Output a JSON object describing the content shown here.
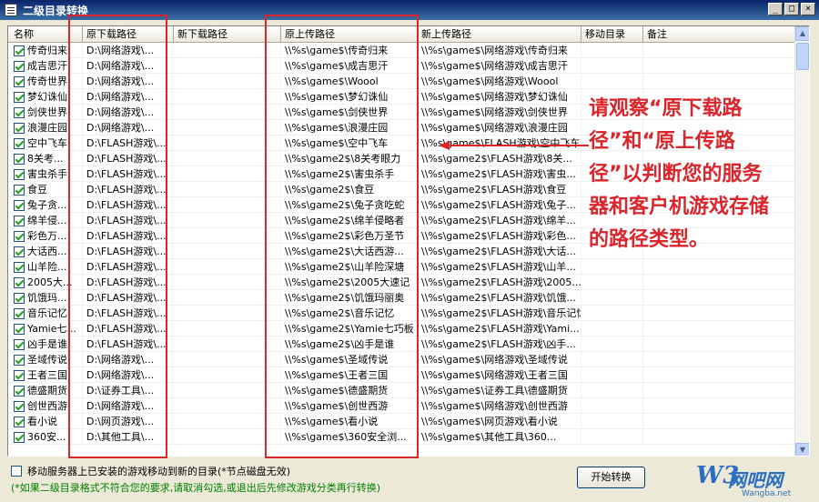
{
  "window": {
    "title": "二级目录转换",
    "controls": [
      "_",
      "□",
      "×"
    ]
  },
  "columns": [
    "名称",
    "原下载路径",
    "新下载路径",
    "原上传路径",
    "新上传路径",
    "移动目录",
    "备注"
  ],
  "rows": [
    {
      "checked": true,
      "name": "传奇归来",
      "orig_dl": "D:\\网络游戏\\...",
      "new_dl": "",
      "orig_ul": "\\\\%s\\game$\\传奇归来",
      "new_ul": "\\\\%s\\game$\\网络游戏\\传奇归来"
    },
    {
      "checked": true,
      "name": "成吉思汗",
      "orig_dl": "D:\\网络游戏\\...",
      "new_dl": "",
      "orig_ul": "\\\\%s\\game$\\成吉思汗",
      "new_ul": "\\\\%s\\game$\\网络游戏\\成吉思汗"
    },
    {
      "checked": true,
      "name": "传奇世界",
      "orig_dl": "D:\\网络游戏\\...",
      "new_dl": "",
      "orig_ul": "\\\\%s\\game$\\Woool",
      "new_ul": "\\\\%s\\game$\\网络游戏\\Woool"
    },
    {
      "checked": true,
      "name": "梦幻诛仙",
      "orig_dl": "D:\\网络游戏\\...",
      "new_dl": "",
      "orig_ul": "\\\\%s\\game$\\梦幻诛仙",
      "new_ul": "\\\\%s\\game$\\网络游戏\\梦幻诛仙"
    },
    {
      "checked": true,
      "name": "剑侠世界",
      "orig_dl": "D:\\网络游戏\\...",
      "new_dl": "",
      "orig_ul": "\\\\%s\\game$\\剑侠世界",
      "new_ul": "\\\\%s\\game$\\网络游戏\\剑侠世界"
    },
    {
      "checked": true,
      "name": "浪漫庄园",
      "orig_dl": "D:\\网络游戏\\...",
      "new_dl": "",
      "orig_ul": "\\\\%s\\game$\\浪漫庄园",
      "new_ul": "\\\\%s\\game$\\网络游戏\\浪漫庄园"
    },
    {
      "checked": true,
      "name": "空中飞车",
      "orig_dl": "D:\\FLASH游戏\\...",
      "new_dl": "",
      "orig_ul": "\\\\%s\\game$\\空中飞车",
      "new_ul": "\\\\%s\\game$\\FLASH游戏\\空中飞车"
    },
    {
      "checked": true,
      "name": "8关考...",
      "orig_dl": "D:\\FLASH游戏\\...",
      "new_dl": "",
      "orig_ul": "\\\\%s\\game2$\\8关考眼力",
      "new_ul": "\\\\%s\\game2$\\FLASH游戏\\8关..."
    },
    {
      "checked": true,
      "name": "害虫杀手",
      "orig_dl": "D:\\FLASH游戏\\...",
      "new_dl": "",
      "orig_ul": "\\\\%s\\game2$\\害虫杀手",
      "new_ul": "\\\\%s\\game2$\\FLASH游戏\\害虫..."
    },
    {
      "checked": true,
      "name": "食豆",
      "orig_dl": "D:\\FLASH游戏\\...",
      "new_dl": "",
      "orig_ul": "\\\\%s\\game2$\\食豆",
      "new_ul": "\\\\%s\\game2$\\FLASH游戏\\食豆"
    },
    {
      "checked": true,
      "name": "兔子贪...",
      "orig_dl": "D:\\FLASH游戏\\...",
      "new_dl": "",
      "orig_ul": "\\\\%s\\game2$\\兔子贪吃蛇",
      "new_ul": "\\\\%s\\game2$\\FLASH游戏\\兔子..."
    },
    {
      "checked": true,
      "name": "绵羊侵...",
      "orig_dl": "D:\\FLASH游戏\\...",
      "new_dl": "",
      "orig_ul": "\\\\%s\\game2$\\绵羊侵略者",
      "new_ul": "\\\\%s\\game2$\\FLASH游戏\\绵羊..."
    },
    {
      "checked": true,
      "name": "彩色万...",
      "orig_dl": "D:\\FLASH游戏\\...",
      "new_dl": "",
      "orig_ul": "\\\\%s\\game2$\\彩色万圣节",
      "new_ul": "\\\\%s\\game2$\\FLASH游戏\\彩色..."
    },
    {
      "checked": true,
      "name": "大话西...",
      "orig_dl": "D:\\FLASH游戏\\...",
      "new_dl": "",
      "orig_ul": "\\\\%s\\game2$\\大话西游...",
      "new_ul": "\\\\%s\\game2$\\FLASH游戏\\大话..."
    },
    {
      "checked": true,
      "name": "山羊险...",
      "orig_dl": "D:\\FLASH游戏\\...",
      "new_dl": "",
      "orig_ul": "\\\\%s\\game2$\\山羊险深塘",
      "new_ul": "\\\\%s\\game2$\\FLASH游戏\\山羊..."
    },
    {
      "checked": true,
      "name": "2005大...",
      "orig_dl": "D:\\FLASH游戏\\...",
      "new_dl": "",
      "orig_ul": "\\\\%s\\game2$\\2005大速记",
      "new_ul": "\\\\%s\\game2$\\FLASH游戏\\2005..."
    },
    {
      "checked": true,
      "name": "饥饿玛...",
      "orig_dl": "D:\\FLASH游戏\\...",
      "new_dl": "",
      "orig_ul": "\\\\%s\\game2$\\饥饿玛丽奥",
      "new_ul": "\\\\%s\\game2$\\FLASH游戏\\饥饿..."
    },
    {
      "checked": true,
      "name": "音乐记忆",
      "orig_dl": "D:\\FLASH游戏\\...",
      "new_dl": "",
      "orig_ul": "\\\\%s\\game2$\\音乐记忆",
      "new_ul": "\\\\%s\\game2$\\FLASH游戏\\音乐记忆"
    },
    {
      "checked": true,
      "name": "Yamie七...",
      "orig_dl": "D:\\FLASH游戏\\...",
      "new_dl": "",
      "orig_ul": "\\\\%s\\game2$\\Yamie七巧板",
      "new_ul": "\\\\%s\\game2$\\FLASH游戏\\Yami..."
    },
    {
      "checked": true,
      "name": "凶手是谁",
      "orig_dl": "D:\\FLASH游戏\\...",
      "new_dl": "",
      "orig_ul": "\\\\%s\\game2$\\凶手是谁",
      "new_ul": "\\\\%s\\game2$\\FLASH游戏\\凶手..."
    },
    {
      "checked": true,
      "name": "圣域传说",
      "orig_dl": "D:\\网络游戏\\...",
      "new_dl": "",
      "orig_ul": "\\\\%s\\game$\\圣域传说",
      "new_ul": "\\\\%s\\game$\\网络游戏\\圣域传说"
    },
    {
      "checked": true,
      "name": "王者三国",
      "orig_dl": "D:\\网络游戏\\...",
      "new_dl": "",
      "orig_ul": "\\\\%s\\game$\\王者三国",
      "new_ul": "\\\\%s\\game$\\网络游戏\\王者三国"
    },
    {
      "checked": true,
      "name": "德盛期货",
      "orig_dl": "D:\\证券工具\\...",
      "new_dl": "",
      "orig_ul": "\\\\%s\\game$\\德盛期货",
      "new_ul": "\\\\%s\\game$\\证券工具\\德盛期货"
    },
    {
      "checked": true,
      "name": "创世西游",
      "orig_dl": "D:\\网络游戏\\...",
      "new_dl": "",
      "orig_ul": "\\\\%s\\game$\\创世西游",
      "new_ul": "\\\\%s\\game$\\网络游戏\\创世西游"
    },
    {
      "checked": true,
      "name": "看小说",
      "orig_dl": "D:\\网页游戏\\...",
      "new_dl": "",
      "orig_ul": "\\\\%s\\game$\\看小说",
      "new_ul": "\\\\%s\\game$\\网页游戏\\看小说"
    },
    {
      "checked": true,
      "name": "360安...",
      "orig_dl": "D:\\其他工具\\...",
      "new_dl": "",
      "orig_ul": "\\\\%s\\game$\\360安全浏...",
      "new_ul": "\\\\%s\\game$\\其他工具\\360..."
    }
  ],
  "annotation": "请观察“原下载路径”和“原上传路径”以判断您的服务器和客户机游戏存储的路径类型。",
  "move_option": {
    "checked": false,
    "label": "移动服务器上已安装的游戏移动到新的目录(*节点磁盘无效)"
  },
  "note": "(*如果二级目录格式不符合您的要求,请取消勾选,或退出后先修改游戏分类再行转换)",
  "start_button": "开始转换",
  "watermark": {
    "logo": "W3",
    "text": "网吧网",
    "sub": "Wangba.net"
  },
  "colors": {
    "highlight": "#d9252b",
    "note": "#008000",
    "titlebar": "#0a246a"
  }
}
